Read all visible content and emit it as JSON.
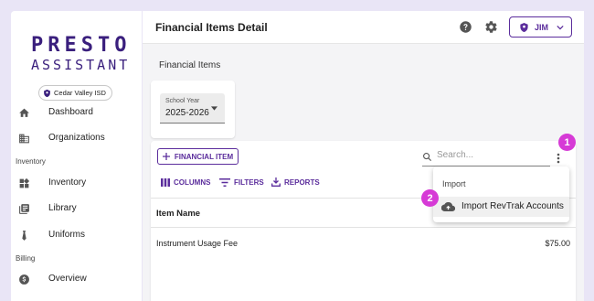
{
  "sidebar": {
    "logo_top": "PRESTO",
    "logo_bottom": "ASSISTANT",
    "org": "Cedar Valley ISD",
    "items": [
      {
        "label": "Dashboard",
        "icon": "home-icon"
      },
      {
        "label": "Organizations",
        "icon": "building-icon"
      },
      {
        "label": "Inventory",
        "icon": "widgets-icon"
      },
      {
        "label": "Library",
        "icon": "library-icon"
      },
      {
        "label": "Uniforms",
        "icon": "tie-icon"
      },
      {
        "label": "Overview",
        "icon": "dollar-icon"
      }
    ],
    "sections": {
      "inventory": "Inventory",
      "billing": "Billing"
    }
  },
  "header": {
    "title": "Financial Items Detail",
    "user": "JIM"
  },
  "main": {
    "section_label": "Financial Items",
    "school_year": {
      "label": "School Year",
      "value": "2025-2026"
    },
    "add_button": "FINANCIAL ITEM",
    "search_placeholder": "Search...",
    "toolbar": {
      "columns": "COLUMNS",
      "filters": "FILTERS",
      "reports": "REPORTS"
    },
    "table": {
      "header": "Item Name",
      "rows": [
        {
          "name": "Instrument Usage Fee",
          "amount": "$75.00"
        }
      ]
    }
  },
  "menu": {
    "header": "Import",
    "item": "Import RevTrak Accounts"
  },
  "badges": [
    "1",
    "2"
  ],
  "colors": {
    "brand": "#3a1f7d",
    "accent": "#5b2d9c",
    "badge": "#d63ad6",
    "background": "#e9e5f6"
  }
}
